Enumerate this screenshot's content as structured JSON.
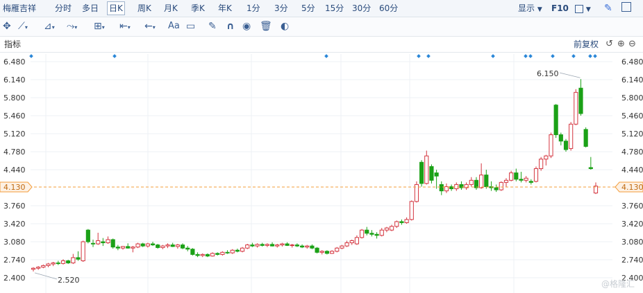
{
  "topbar": {
    "stock_name": "梅雁吉祥",
    "periods": [
      "分时",
      "多日",
      "日K",
      "周K",
      "月K",
      "季K",
      "年K",
      "1分",
      "3分",
      "5分",
      "15分",
      "30分",
      "60分"
    ],
    "active_period": "日K",
    "display_label": "显示",
    "f10_label": "F10"
  },
  "toolbar": {
    "icons": [
      "crosshair-icon",
      "line-tool-icon",
      "channel-tool-icon",
      "wave-tool-icon",
      "fib-tool-icon",
      "range-tool-icon",
      "arrow-left-icon",
      "text-tool-icon",
      "comment-icon",
      "pen-icon",
      "magnet-icon",
      "eye-icon",
      "trash-icon",
      "toggle-icon"
    ],
    "text_tool_label": "Aa"
  },
  "indicator_bar": {
    "label": "指标",
    "adjust_label": "前复权"
  },
  "colors": {
    "up": "#d4343e",
    "down": "#1ba117",
    "accent": "#3a5f93",
    "current_line": "#f39c3a",
    "marker": "#2a87d8"
  },
  "price_axis": {
    "ticks": [
      "6.480",
      "6.140",
      "5.800",
      "5.460",
      "5.120",
      "4.780",
      "4.440",
      "4.130",
      "3.760",
      "3.420",
      "3.080",
      "2.740",
      "2.400"
    ],
    "current_price": "4.130"
  },
  "annotations": {
    "high_label": "6.150",
    "low_label": "2.520"
  },
  "watermark": "@格隆汇",
  "chart_data": {
    "type": "candlestick",
    "ylim": [
      2.4,
      6.48
    ],
    "candles": [
      {
        "o": 2.56,
        "h": 2.6,
        "l": 2.52,
        "c": 2.58
      },
      {
        "o": 2.58,
        "h": 2.62,
        "l": 2.55,
        "c": 2.6
      },
      {
        "o": 2.6,
        "h": 2.65,
        "l": 2.58,
        "c": 2.63
      },
      {
        "o": 2.63,
        "h": 2.68,
        "l": 2.6,
        "c": 2.66
      },
      {
        "o": 2.66,
        "h": 2.7,
        "l": 2.62,
        "c": 2.68
      },
      {
        "o": 2.68,
        "h": 2.72,
        "l": 2.64,
        "c": 2.67
      },
      {
        "o": 2.67,
        "h": 2.75,
        "l": 2.65,
        "c": 2.72
      },
      {
        "o": 2.72,
        "h": 2.74,
        "l": 2.66,
        "c": 2.68
      },
      {
        "o": 2.68,
        "h": 2.85,
        "l": 2.66,
        "c": 2.78
      },
      {
        "o": 2.78,
        "h": 2.9,
        "l": 2.72,
        "c": 2.75
      },
      {
        "o": 2.72,
        "h": 3.1,
        "l": 2.7,
        "c": 3.08
      },
      {
        "o": 3.3,
        "h": 3.32,
        "l": 3.05,
        "c": 3.08
      },
      {
        "o": 3.05,
        "h": 3.12,
        "l": 2.98,
        "c": 3.04
      },
      {
        "o": 3.04,
        "h": 3.25,
        "l": 3.02,
        "c": 3.1
      },
      {
        "o": 3.08,
        "h": 3.15,
        "l": 3.0,
        "c": 3.06
      },
      {
        "o": 3.06,
        "h": 3.18,
        "l": 3.04,
        "c": 3.12
      },
      {
        "o": 3.12,
        "h": 3.14,
        "l": 2.95,
        "c": 2.98
      },
      {
        "o": 2.98,
        "h": 3.02,
        "l": 2.92,
        "c": 2.96
      },
      {
        "o": 2.96,
        "h": 3.0,
        "l": 2.93,
        "c": 2.99
      },
      {
        "o": 2.99,
        "h": 3.05,
        "l": 2.95,
        "c": 2.96
      },
      {
        "o": 2.96,
        "h": 3.0,
        "l": 2.88,
        "c": 2.98
      },
      {
        "o": 2.98,
        "h": 3.06,
        "l": 2.96,
        "c": 3.04
      },
      {
        "o": 3.04,
        "h": 3.06,
        "l": 2.98,
        "c": 3.0
      },
      {
        "o": 3.0,
        "h": 3.06,
        "l": 2.97,
        "c": 3.04
      },
      {
        "o": 3.04,
        "h": 3.08,
        "l": 3.0,
        "c": 3.02
      },
      {
        "o": 3.02,
        "h": 3.04,
        "l": 2.95,
        "c": 2.97
      },
      {
        "o": 2.97,
        "h": 3.02,
        "l": 2.94,
        "c": 3.0
      },
      {
        "o": 3.0,
        "h": 3.05,
        "l": 2.96,
        "c": 3.02
      },
      {
        "o": 3.02,
        "h": 3.06,
        "l": 2.98,
        "c": 2.99
      },
      {
        "o": 2.99,
        "h": 3.04,
        "l": 2.95,
        "c": 3.02
      },
      {
        "o": 3.02,
        "h": 3.05,
        "l": 2.94,
        "c": 2.96
      },
      {
        "o": 2.96,
        "h": 3.0,
        "l": 2.9,
        "c": 2.94
      },
      {
        "o": 2.94,
        "h": 2.96,
        "l": 2.82,
        "c": 2.84
      },
      {
        "o": 2.84,
        "h": 2.88,
        "l": 2.79,
        "c": 2.82
      },
      {
        "o": 2.82,
        "h": 2.86,
        "l": 2.79,
        "c": 2.84
      },
      {
        "o": 2.84,
        "h": 2.86,
        "l": 2.79,
        "c": 2.81
      },
      {
        "o": 2.81,
        "h": 2.88,
        "l": 2.8,
        "c": 2.86
      },
      {
        "o": 2.86,
        "h": 2.88,
        "l": 2.82,
        "c": 2.84
      },
      {
        "o": 2.84,
        "h": 2.9,
        "l": 2.82,
        "c": 2.88
      },
      {
        "o": 2.88,
        "h": 2.92,
        "l": 2.85,
        "c": 2.87
      },
      {
        "o": 2.87,
        "h": 2.94,
        "l": 2.85,
        "c": 2.92
      },
      {
        "o": 2.92,
        "h": 2.95,
        "l": 2.88,
        "c": 2.9
      },
      {
        "o": 2.9,
        "h": 2.98,
        "l": 2.88,
        "c": 2.96
      },
      {
        "o": 2.96,
        "h": 3.04,
        "l": 2.94,
        "c": 3.02
      },
      {
        "o": 3.02,
        "h": 3.06,
        "l": 2.98,
        "c": 3.0
      },
      {
        "o": 3.0,
        "h": 3.05,
        "l": 2.97,
        "c": 3.03
      },
      {
        "o": 3.03,
        "h": 3.06,
        "l": 2.99,
        "c": 3.01
      },
      {
        "o": 3.01,
        "h": 3.05,
        "l": 2.98,
        "c": 3.03
      },
      {
        "o": 3.03,
        "h": 3.07,
        "l": 2.99,
        "c": 3.0
      },
      {
        "o": 3.0,
        "h": 3.04,
        "l": 2.97,
        "c": 3.02
      },
      {
        "o": 3.02,
        "h": 3.06,
        "l": 2.99,
        "c": 3.04
      },
      {
        "o": 3.04,
        "h": 3.07,
        "l": 3.0,
        "c": 3.01
      },
      {
        "o": 3.01,
        "h": 3.04,
        "l": 2.97,
        "c": 3.02
      },
      {
        "o": 3.02,
        "h": 3.05,
        "l": 2.98,
        "c": 3.0
      },
      {
        "o": 3.0,
        "h": 3.03,
        "l": 2.96,
        "c": 2.98
      },
      {
        "o": 2.98,
        "h": 3.02,
        "l": 2.95,
        "c": 3.0
      },
      {
        "o": 3.0,
        "h": 3.03,
        "l": 2.94,
        "c": 2.96
      },
      {
        "o": 2.96,
        "h": 2.98,
        "l": 2.86,
        "c": 2.88
      },
      {
        "o": 2.88,
        "h": 2.92,
        "l": 2.84,
        "c": 2.9
      },
      {
        "o": 2.9,
        "h": 2.92,
        "l": 2.84,
        "c": 2.86
      },
      {
        "o": 2.86,
        "h": 2.92,
        "l": 2.85,
        "c": 2.9
      },
      {
        "o": 2.9,
        "h": 2.98,
        "l": 2.88,
        "c": 2.96
      },
      {
        "o": 2.96,
        "h": 3.02,
        "l": 2.94,
        "c": 3.0
      },
      {
        "o": 3.0,
        "h": 3.1,
        "l": 2.98,
        "c": 3.06
      },
      {
        "o": 3.06,
        "h": 3.12,
        "l": 3.02,
        "c": 3.1
      },
      {
        "o": 3.04,
        "h": 3.2,
        "l": 3.02,
        "c": 3.16
      },
      {
        "o": 3.16,
        "h": 3.32,
        "l": 3.14,
        "c": 3.3
      },
      {
        "o": 3.3,
        "h": 3.36,
        "l": 3.2,
        "c": 3.24
      },
      {
        "o": 3.24,
        "h": 3.3,
        "l": 3.18,
        "c": 3.22
      },
      {
        "o": 3.22,
        "h": 3.26,
        "l": 3.14,
        "c": 3.2
      },
      {
        "o": 3.2,
        "h": 3.34,
        "l": 3.18,
        "c": 3.3
      },
      {
        "o": 3.3,
        "h": 3.36,
        "l": 3.26,
        "c": 3.34
      },
      {
        "o": 3.3,
        "h": 3.4,
        "l": 3.28,
        "c": 3.37
      },
      {
        "o": 3.37,
        "h": 3.48,
        "l": 3.34,
        "c": 3.46
      },
      {
        "o": 3.46,
        "h": 3.5,
        "l": 3.4,
        "c": 3.44
      },
      {
        "o": 3.44,
        "h": 3.54,
        "l": 3.42,
        "c": 3.5
      },
      {
        "o": 3.5,
        "h": 3.86,
        "l": 3.48,
        "c": 3.84
      },
      {
        "o": 3.84,
        "h": 4.22,
        "l": 3.82,
        "c": 4.16
      },
      {
        "o": 4.58,
        "h": 4.62,
        "l": 4.12,
        "c": 4.18
      },
      {
        "o": 4.18,
        "h": 4.8,
        "l": 4.16,
        "c": 4.7
      },
      {
        "o": 4.5,
        "h": 4.54,
        "l": 4.18,
        "c": 4.24
      },
      {
        "o": 4.38,
        "h": 4.44,
        "l": 4.08,
        "c": 4.32
      },
      {
        "o": 4.16,
        "h": 4.22,
        "l": 3.96,
        "c": 4.04
      },
      {
        "o": 4.04,
        "h": 4.18,
        "l": 4.0,
        "c": 4.12
      },
      {
        "o": 4.12,
        "h": 4.16,
        "l": 4.04,
        "c": 4.08
      },
      {
        "o": 4.08,
        "h": 4.2,
        "l": 4.04,
        "c": 4.16
      },
      {
        "o": 4.16,
        "h": 4.22,
        "l": 4.06,
        "c": 4.1
      },
      {
        "o": 4.1,
        "h": 4.2,
        "l": 4.06,
        "c": 4.16
      },
      {
        "o": 4.16,
        "h": 4.3,
        "l": 4.12,
        "c": 4.24
      },
      {
        "o": 4.24,
        "h": 4.3,
        "l": 4.06,
        "c": 4.1
      },
      {
        "o": 4.1,
        "h": 4.56,
        "l": 4.08,
        "c": 4.34
      },
      {
        "o": 4.34,
        "h": 4.44,
        "l": 4.08,
        "c": 4.12
      },
      {
        "o": 4.12,
        "h": 4.22,
        "l": 4.04,
        "c": 4.1
      },
      {
        "o": 4.1,
        "h": 4.16,
        "l": 4.02,
        "c": 4.06
      },
      {
        "o": 4.06,
        "h": 4.22,
        "l": 4.04,
        "c": 4.2
      },
      {
        "o": 4.2,
        "h": 4.28,
        "l": 4.12,
        "c": 4.24
      },
      {
        "o": 4.24,
        "h": 4.42,
        "l": 4.22,
        "c": 4.38
      },
      {
        "o": 4.38,
        "h": 4.46,
        "l": 4.22,
        "c": 4.26
      },
      {
        "o": 4.26,
        "h": 4.4,
        "l": 4.2,
        "c": 4.24
      },
      {
        "o": 4.24,
        "h": 4.32,
        "l": 4.2,
        "c": 4.28
      },
      {
        "o": 4.22,
        "h": 4.26,
        "l": 4.16,
        "c": 4.2
      },
      {
        "o": 4.22,
        "h": 4.5,
        "l": 4.2,
        "c": 4.46
      },
      {
        "o": 4.46,
        "h": 4.68,
        "l": 4.42,
        "c": 4.64
      },
      {
        "o": 4.64,
        "h": 4.72,
        "l": 4.52,
        "c": 4.7
      },
      {
        "o": 4.7,
        "h": 5.14,
        "l": 4.66,
        "c": 5.1
      },
      {
        "o": 5.66,
        "h": 5.68,
        "l": 5.04,
        "c": 5.1
      },
      {
        "o": 5.1,
        "h": 5.14,
        "l": 4.9,
        "c": 4.98
      },
      {
        "o": 4.98,
        "h": 5.02,
        "l": 4.78,
        "c": 4.82
      },
      {
        "o": 4.84,
        "h": 5.34,
        "l": 4.8,
        "c": 5.3
      },
      {
        "o": 5.3,
        "h": 5.96,
        "l": 5.28,
        "c": 5.9
      },
      {
        "o": 5.98,
        "h": 6.15,
        "l": 5.46,
        "c": 5.5
      },
      {
        "o": 5.2,
        "h": 5.24,
        "l": 4.86,
        "c": 4.88
      },
      {
        "o": 4.48,
        "h": 4.68,
        "l": 4.44,
        "c": 4.46
      },
      {
        "o": 4.0,
        "h": 4.2,
        "l": 3.98,
        "c": 4.13
      }
    ]
  }
}
